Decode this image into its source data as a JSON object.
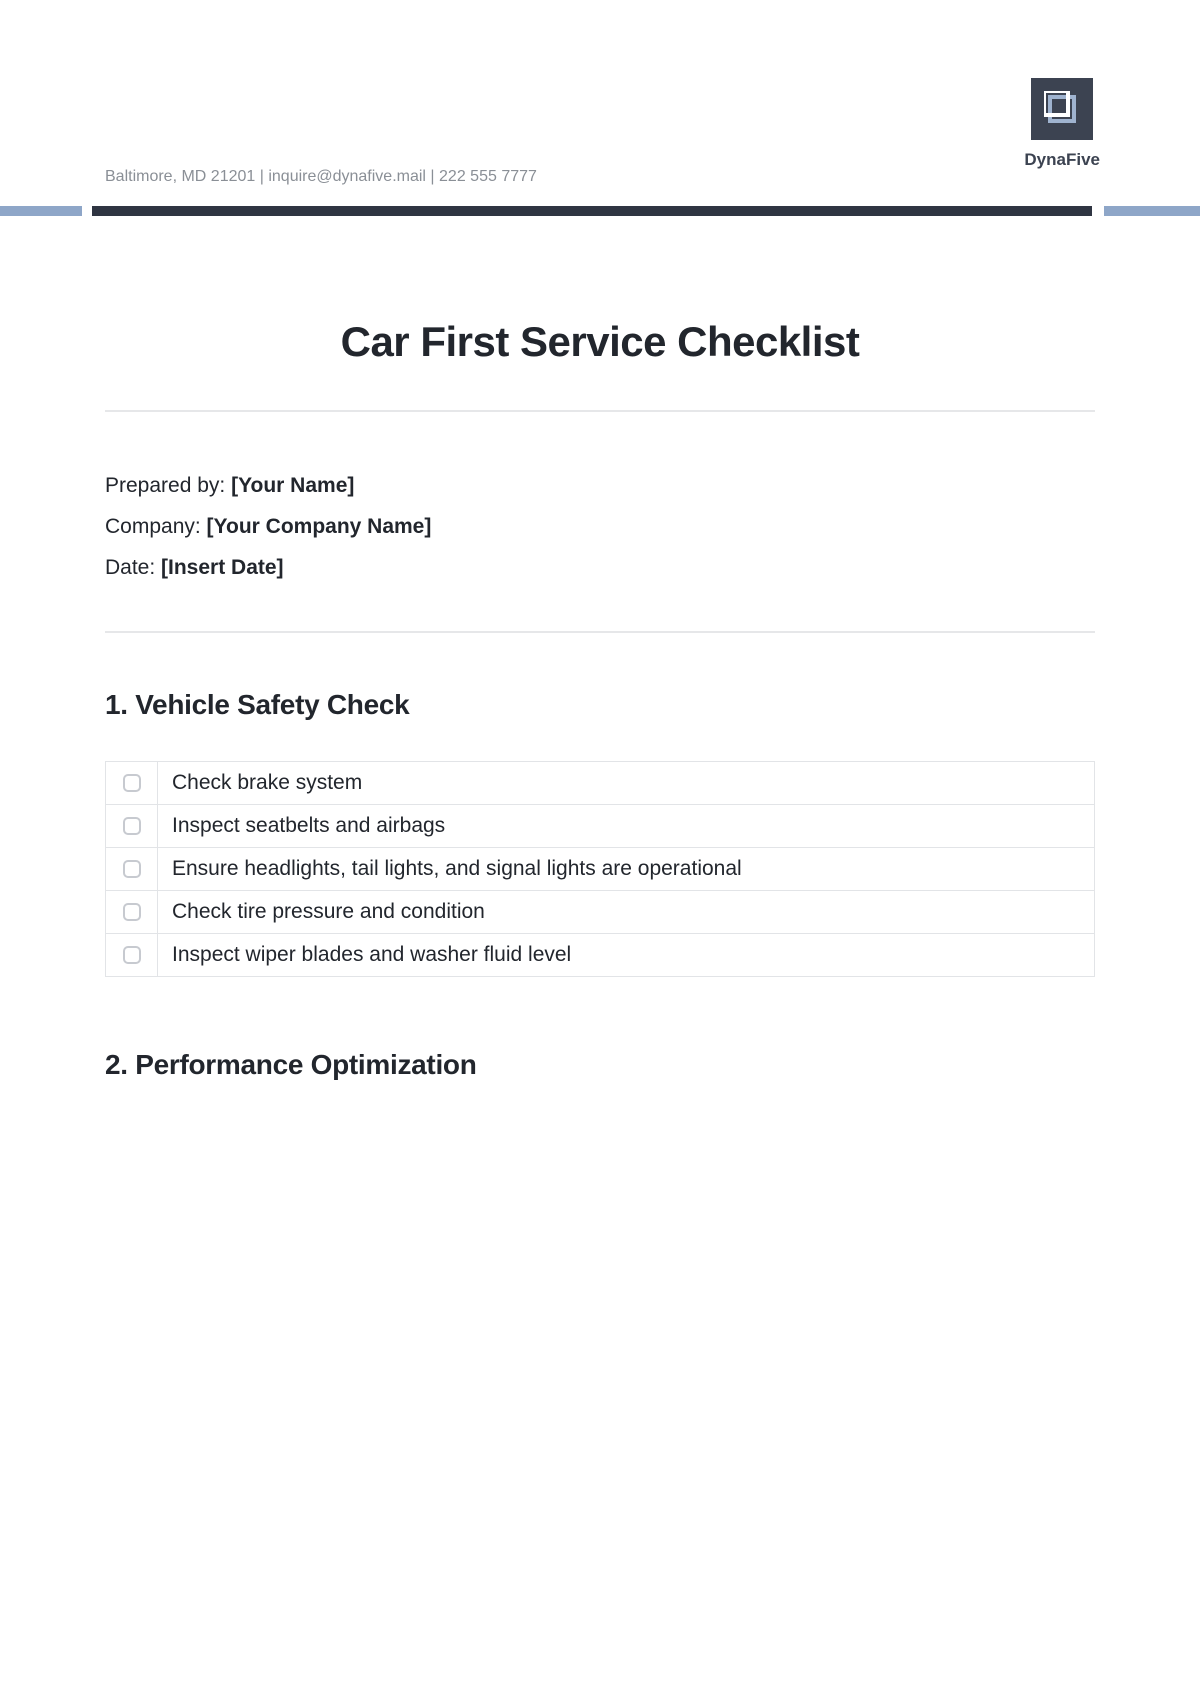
{
  "header": {
    "contact_line": "Baltimore, MD 21201 | inquire@dynafive.mail | 222 555 7777",
    "brand": "DynaFive"
  },
  "title": "Car First Service Checklist",
  "meta": {
    "prepared_label": "Prepared by: ",
    "prepared_value": "[Your Name]",
    "company_label": "Company: ",
    "company_value": "[Your Company Name]",
    "date_label": "Date: ",
    "date_value": "[Insert Date]"
  },
  "sections": [
    {
      "heading": "1. Vehicle Safety Check",
      "items": [
        "Check brake system",
        "Inspect seatbelts and airbags",
        "Ensure headlights, tail lights, and signal lights are operational",
        "Check tire pressure and condition",
        "Inspect wiper blades and washer fluid level"
      ]
    },
    {
      "heading": "2. Performance Optimization",
      "items": []
    }
  ]
}
